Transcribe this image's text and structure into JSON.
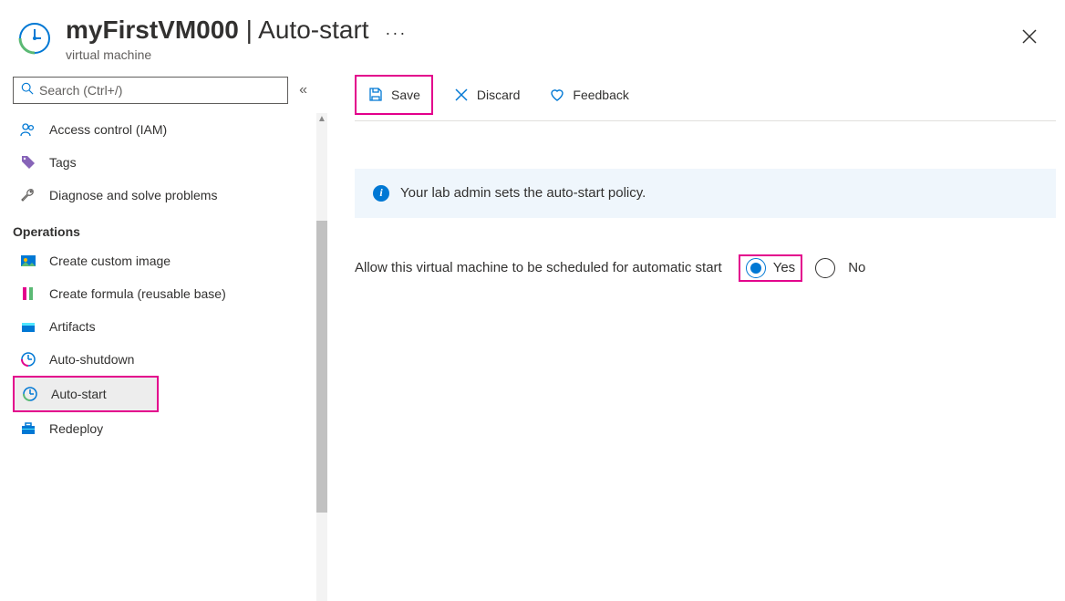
{
  "header": {
    "resource_name": "myFirstVM000",
    "page_name": "Auto-start",
    "subtitle": "virtual machine"
  },
  "search": {
    "placeholder": "Search (Ctrl+/)"
  },
  "toolbar": {
    "save_label": "Save",
    "discard_label": "Discard",
    "feedback_label": "Feedback"
  },
  "sidebar": {
    "top": [
      {
        "label": "Access control (IAM)",
        "icon": "people-icon"
      },
      {
        "label": "Tags",
        "icon": "tag-icon"
      },
      {
        "label": "Diagnose and solve problems",
        "icon": "wrench-icon"
      }
    ],
    "operations_header": "Operations",
    "ops": [
      {
        "label": "Create custom image",
        "icon": "image-icon"
      },
      {
        "label": "Create formula (reusable base)",
        "icon": "flask-icon"
      },
      {
        "label": "Artifacts",
        "icon": "package-icon"
      },
      {
        "label": "Auto-shutdown",
        "icon": "clock-red-icon"
      },
      {
        "label": "Auto-start",
        "icon": "clock-blue-icon",
        "selected": true,
        "highlight": true
      },
      {
        "label": "Redeploy",
        "icon": "briefcase-icon"
      }
    ]
  },
  "banner": {
    "text": "Your lab admin sets the auto-start policy."
  },
  "setting": {
    "label": "Allow this virtual machine to be scheduled for automatic start",
    "yes_label": "Yes",
    "no_label": "No",
    "value": "yes"
  }
}
